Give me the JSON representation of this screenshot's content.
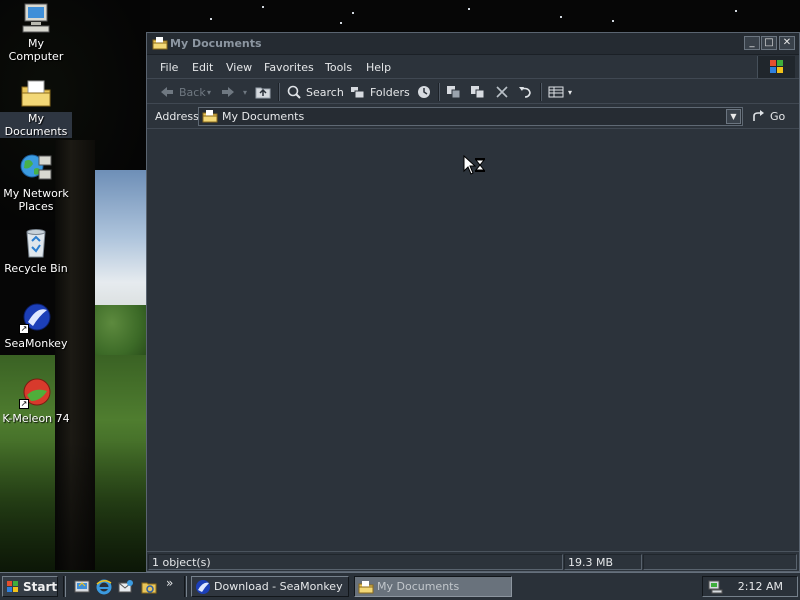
{
  "desktop": {
    "icons": [
      {
        "label": "My Computer"
      },
      {
        "label": "My Documents"
      },
      {
        "label": "My Network Places"
      },
      {
        "label": "Recycle Bin"
      },
      {
        "label": "SeaMonkey"
      },
      {
        "label": "K-Meleon 74"
      }
    ]
  },
  "window": {
    "title": "My Documents",
    "controls": {
      "minimize": "_",
      "maximize": "□",
      "close": "✕"
    },
    "menu": [
      "File",
      "Edit",
      "View",
      "Favorites",
      "Tools",
      "Help"
    ],
    "toolbar": {
      "back": "Back",
      "search": "Search",
      "folders": "Folders"
    },
    "address": {
      "label": "Address",
      "value": "My Documents",
      "go": "Go"
    },
    "status": {
      "objects": "1 object(s)",
      "size": "19.3 MB"
    }
  },
  "taskbar": {
    "start": "Start",
    "chevron": "»",
    "tasks": [
      {
        "label": "Download - SeaMonkey",
        "active": false
      },
      {
        "label": "My Documents",
        "active": true
      }
    ],
    "clock": "2:12 AM"
  },
  "colors": {
    "window_bg": "#2c333b",
    "title_text": "#8c96a1",
    "taskbar_bg": "#2a3139",
    "active_task": "#69727c"
  }
}
